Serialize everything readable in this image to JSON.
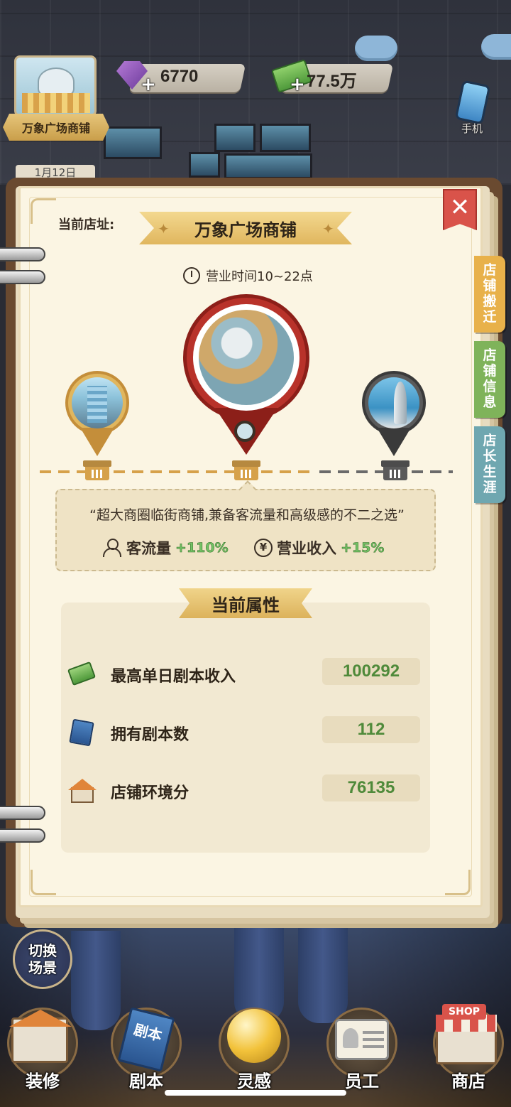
{
  "hud": {
    "gems": "6770",
    "cash": "77.5万",
    "plus": "+",
    "store_name": "万象广场商铺",
    "date": "1月12日",
    "phone_label": "手机"
  },
  "panel": {
    "close_label": "✕",
    "address_label": "当前店址:",
    "store_title": "万象广场商铺",
    "business_hours": "营业时间10~22点",
    "description": "“超大商圈临街商铺,兼备客流量和高级感的不二之选”",
    "traffic_label": "客流量",
    "traffic_bonus": "+110%",
    "income_label": "营业收入",
    "income_bonus": "+15%",
    "yen_symbol": "¥"
  },
  "side_tabs": [
    {
      "label": [
        "店",
        "铺",
        "搬",
        "迁"
      ],
      "color": "#e8b14a"
    },
    {
      "label": [
        "店",
        "铺",
        "信",
        "息"
      ],
      "color": "#7fb35a"
    },
    {
      "label": [
        "店",
        "长",
        "生",
        "涯"
      ],
      "color": "#6fa7b0"
    }
  ],
  "attributes": {
    "title": "当前属性",
    "rows": [
      {
        "label": "最高单日剧本收入",
        "value": "100292",
        "icon": "cash-stack-icon"
      },
      {
        "label": "拥有剧本数",
        "value": "112",
        "icon": "script-book-icon"
      },
      {
        "label": "店铺环境分",
        "value": "76135",
        "icon": "shop-house-icon"
      }
    ]
  },
  "bottom": {
    "switch_scene": [
      "切换",
      "场景"
    ],
    "nav": [
      {
        "label": "装修",
        "icon": "renovate-icon"
      },
      {
        "label": "剧本",
        "icon": "script-icon"
      },
      {
        "label": "灵感",
        "icon": "inspiration-icon"
      },
      {
        "label": "员工",
        "icon": "staff-icon"
      },
      {
        "label": "商店",
        "icon": "shop-icon"
      }
    ],
    "shop_sign": "SHOP",
    "script_cover": "剧本"
  },
  "colors": {
    "accent_gold": "#e0b65e",
    "bonus_green": "#73c165",
    "value_green": "#4f8a3a",
    "close_red": "#d9534a"
  }
}
